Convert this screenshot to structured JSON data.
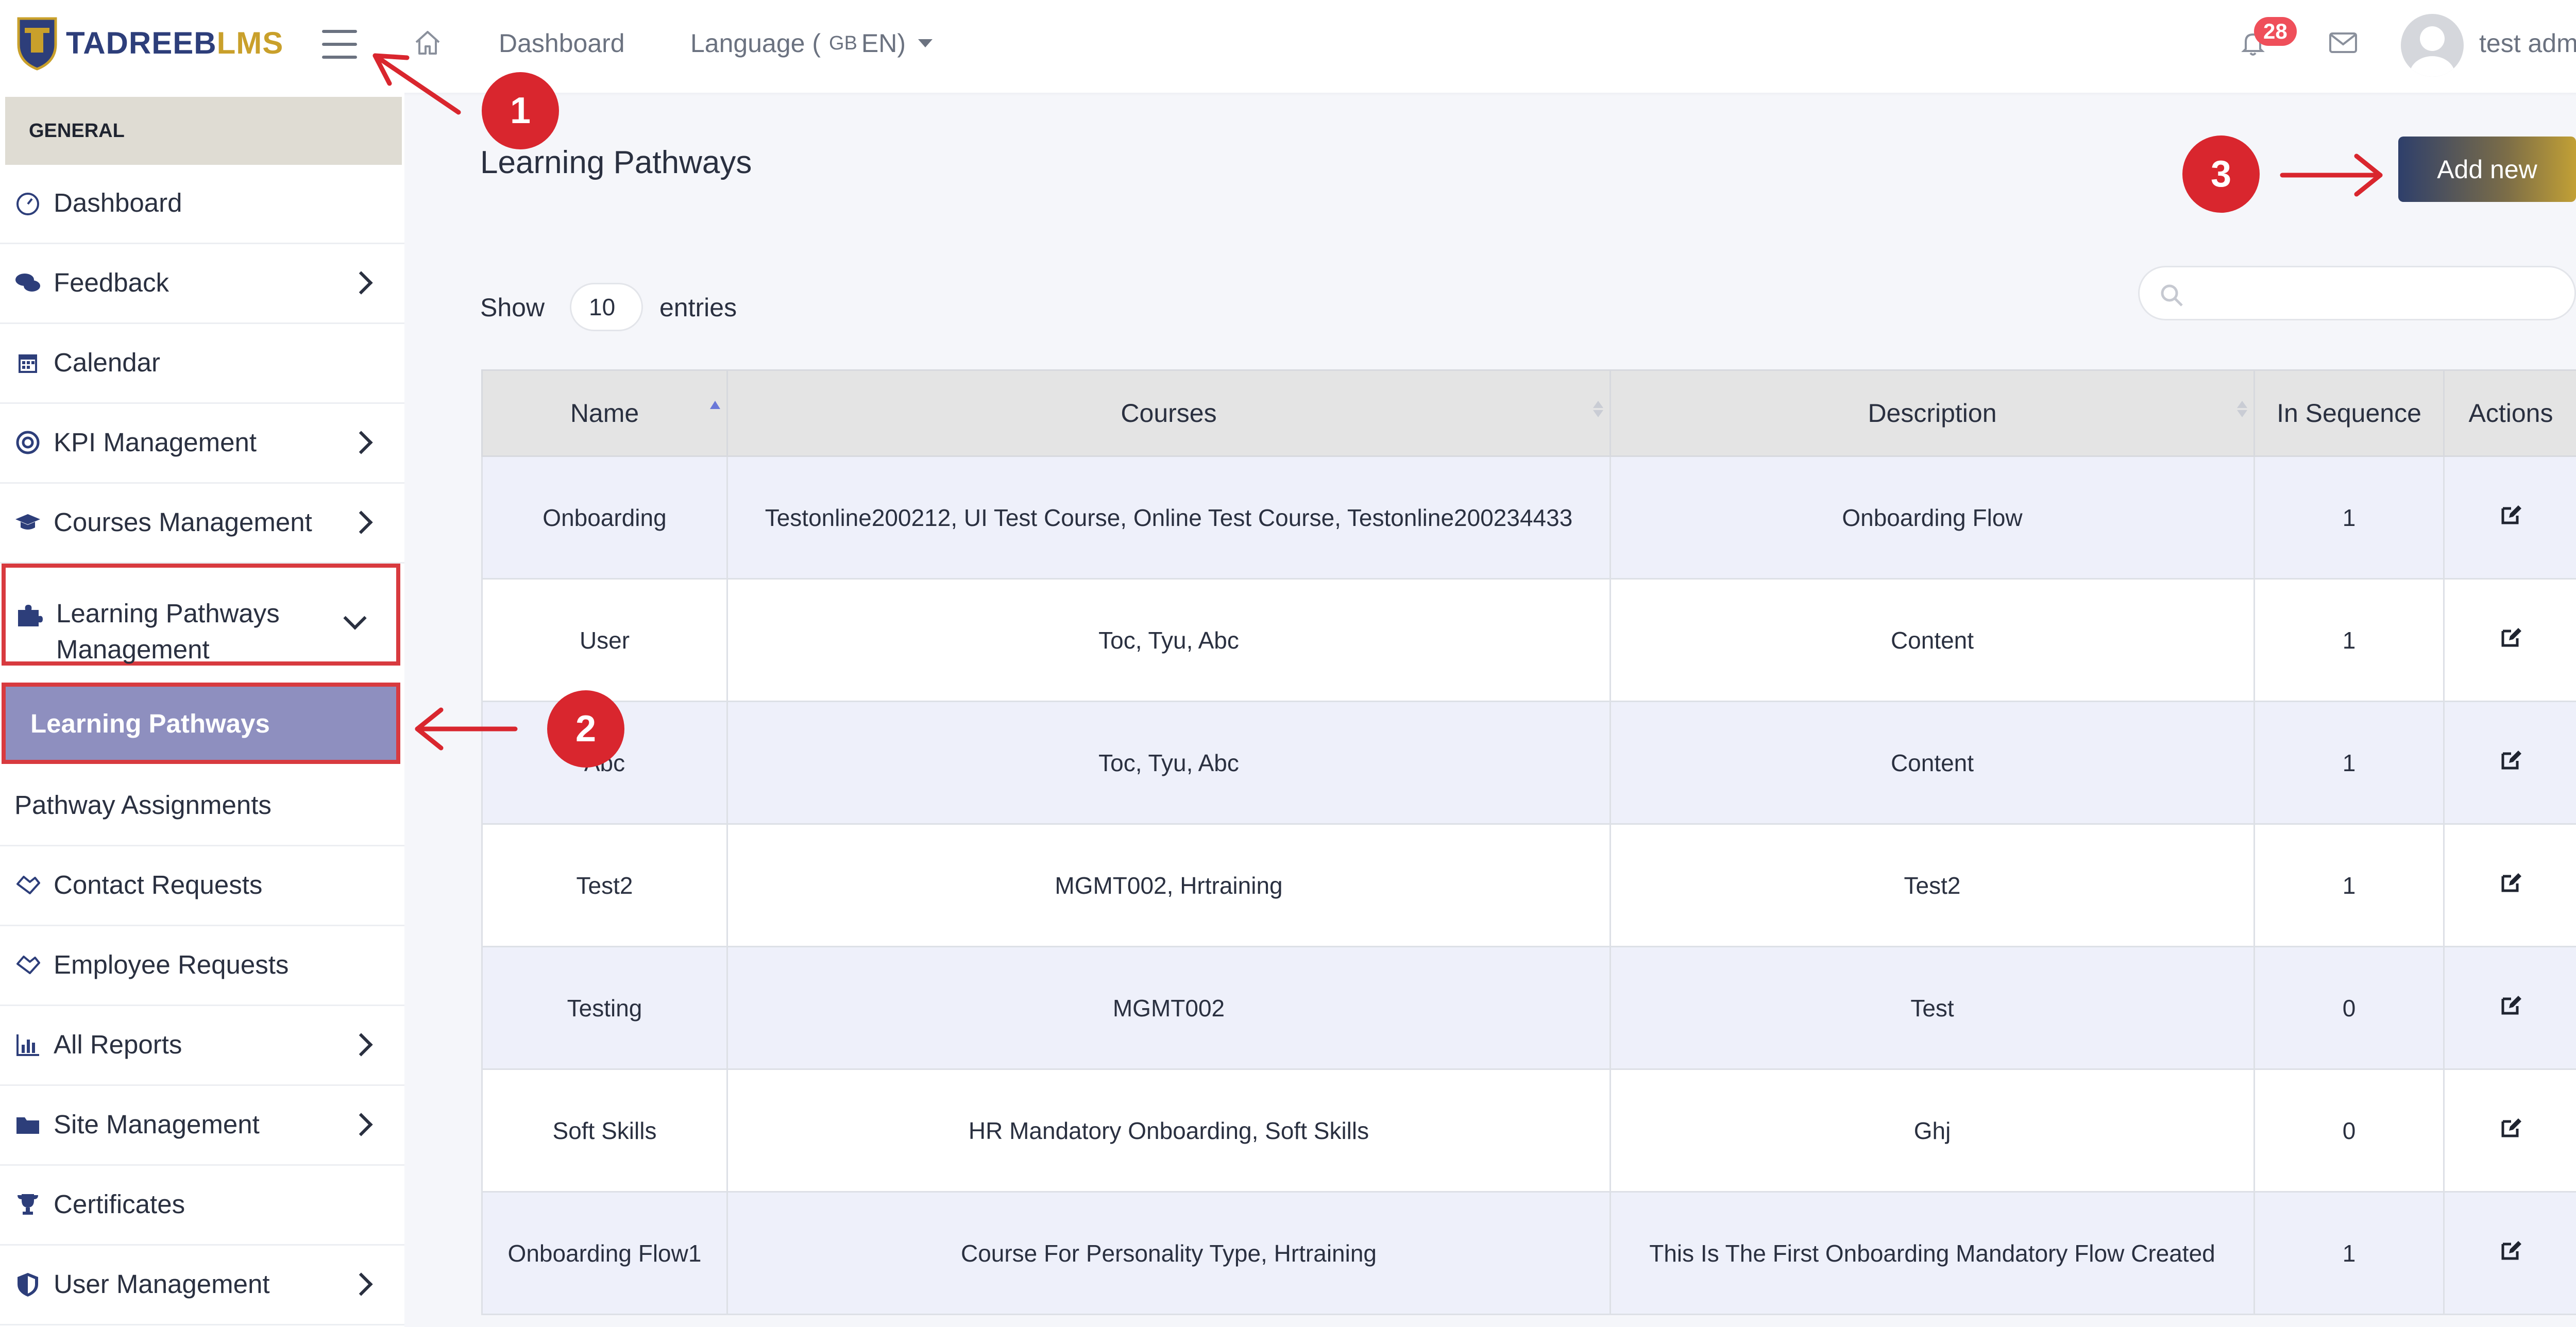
{
  "header": {
    "logo_part1": "TADREEB",
    "logo_part2": "LMS",
    "nav_dashboard": "Dashboard",
    "language_label": "Language (",
    "language_flag": "GB",
    "language_code": "EN)",
    "notification_count": "28",
    "user_name": "test admin"
  },
  "sidebar": {
    "section_label": "GENERAL",
    "items": [
      {
        "label": "Dashboard",
        "icon": "dashboard-icon",
        "expandable": false
      },
      {
        "label": "Feedback",
        "icon": "comments-icon",
        "expandable": true
      },
      {
        "label": "Calendar",
        "icon": "calendar-icon",
        "expandable": false
      },
      {
        "label": "KPI Management",
        "icon": "target-icon",
        "expandable": true
      },
      {
        "label": "Courses Management",
        "icon": "graduation-cap-icon",
        "expandable": true
      },
      {
        "label_line1": "Learning Pathways",
        "label_line2": "Management",
        "icon": "puzzle-icon",
        "expandable": true,
        "expanded": true
      },
      {
        "label": "Learning Pathways",
        "active": true
      },
      {
        "label": "Pathway Assignments"
      },
      {
        "label": "Contact Requests",
        "icon": "handshake-icon"
      },
      {
        "label": "Employee Requests",
        "icon": "handshake-icon"
      },
      {
        "label": "All Reports",
        "icon": "bar-chart-icon",
        "expandable": true
      },
      {
        "label": "Site Management",
        "icon": "folder-icon",
        "expandable": true
      },
      {
        "label": "Certificates",
        "icon": "trophy-icon"
      },
      {
        "label": "User Management",
        "icon": "shield-icon",
        "expandable": true
      }
    ]
  },
  "main": {
    "page_title": "Learning Pathways",
    "add_new_label": "Add new",
    "show_label": "Show",
    "entries_value": "10",
    "entries_label": "entries",
    "columns": [
      "Name",
      "Courses",
      "Description",
      "In Sequence",
      "Actions"
    ],
    "rows": [
      {
        "name": "Onboarding",
        "courses": "Testonline200212, UI Test Course, Online Test Course, Testonline200234433",
        "description": "Onboarding Flow",
        "in_sequence": "1"
      },
      {
        "name": "User",
        "courses": "Toc, Tyu, Abc",
        "description": "Content",
        "in_sequence": "1"
      },
      {
        "name": "Abc",
        "courses": "Toc, Tyu, Abc",
        "description": "Content",
        "in_sequence": "1"
      },
      {
        "name": "Test2",
        "courses": "MGMT002, Hrtraining",
        "description": "Test2",
        "in_sequence": "1"
      },
      {
        "name": "Testing",
        "courses": "MGMT002",
        "description": "Test",
        "in_sequence": "0"
      },
      {
        "name": "Soft Skills",
        "courses": "HR Mandatory Onboarding, Soft Skills",
        "description": "Ghj",
        "in_sequence": "0"
      },
      {
        "name": "Onboarding Flow1",
        "courses": "Course For Personality Type, Hrtraining",
        "description": "This Is The First Onboarding Mandatory Flow Created",
        "in_sequence": "1"
      }
    ]
  },
  "annotations": {
    "step1": "1",
    "step2": "2",
    "step3": "3"
  },
  "colors": {
    "brand_navy": "#2d3e7a",
    "brand_gold": "#c9a02b",
    "highlight_red": "#d83a3f",
    "active_item_bg": "#8e8fbf",
    "badge_red": "#ef4f5a"
  }
}
